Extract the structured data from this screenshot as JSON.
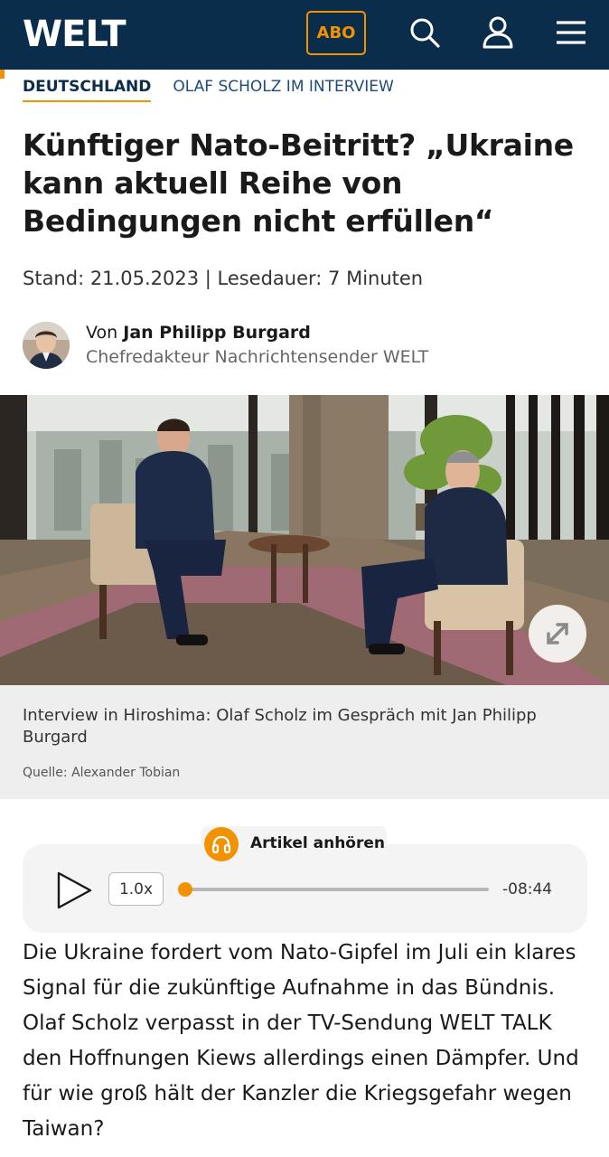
{
  "header": {
    "logo": "WELT",
    "abo_label": "ABO",
    "icons": [
      "search-icon",
      "user-icon",
      "menu-icon"
    ],
    "brand_color": "#0a2d4c",
    "accent_color": "#f39200"
  },
  "breadcrumb": {
    "section": "DEUTSCHLAND",
    "topic": "OLAF SCHOLZ IM INTERVIEW"
  },
  "article": {
    "headline": "Künftiger Nato-Beitritt? „Ukraine kann aktuell Reihe von Bedingungen nicht erfüllen“",
    "meta": "Stand: 21.05.2023 | Lesedauer: 7 Minuten",
    "author_prefix": "Von",
    "author_name": "Jan Philipp Burgard",
    "author_role": "Chefredakteur Nachrichtensender WELT",
    "image_caption": "Interview in Hiroshima: Olaf Scholz im Gespräch mit Jan Philipp Burgard",
    "image_source": "Quelle: Alexander Tobian",
    "intro": "Die Ukraine fordert vom Nato-Gipfel im Juli ein klares Signal für die zukünftige Aufnahme in das Bündnis. Olaf Scholz verpasst in der TV-Sendung WELT TALK den Hoffnungen Kiews allerdings einen Dämpfer. Und für wie groß hält der Kanzler die Kriegsgefahr wegen Taiwan?"
  },
  "audio_player": {
    "label": "Artikel anhören",
    "speed": "1.0x",
    "remaining_time": "-08:44",
    "progress": 0
  }
}
